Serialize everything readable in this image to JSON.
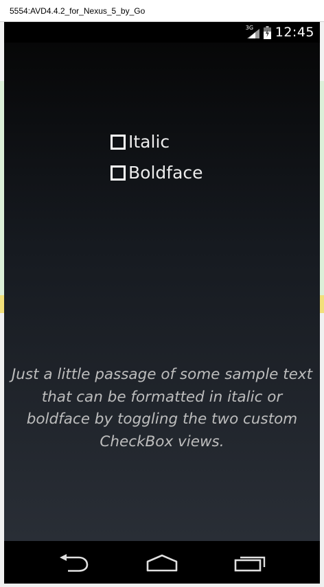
{
  "window": {
    "title": "5554:AVD4.4.2_for_Nexus_5_by_Go"
  },
  "status_bar": {
    "network_label": "3G",
    "time": "12:45",
    "icons": [
      "signal-icon",
      "battery-icon"
    ]
  },
  "checkboxes": [
    {
      "label": "Italic",
      "checked": false
    },
    {
      "label": "Boldface",
      "checked": false
    }
  ],
  "passage": "Just a little passage of some sample text that can be formatted in italic or boldface by toggling the two custom CheckBox views.",
  "nav_bar": {
    "icons": [
      "back-icon",
      "home-icon",
      "recent-apps-icon"
    ]
  },
  "colors": {
    "checkbox_border": "#ffffff",
    "label_text": "#ececec",
    "passage_text": "#bdbdbd"
  }
}
